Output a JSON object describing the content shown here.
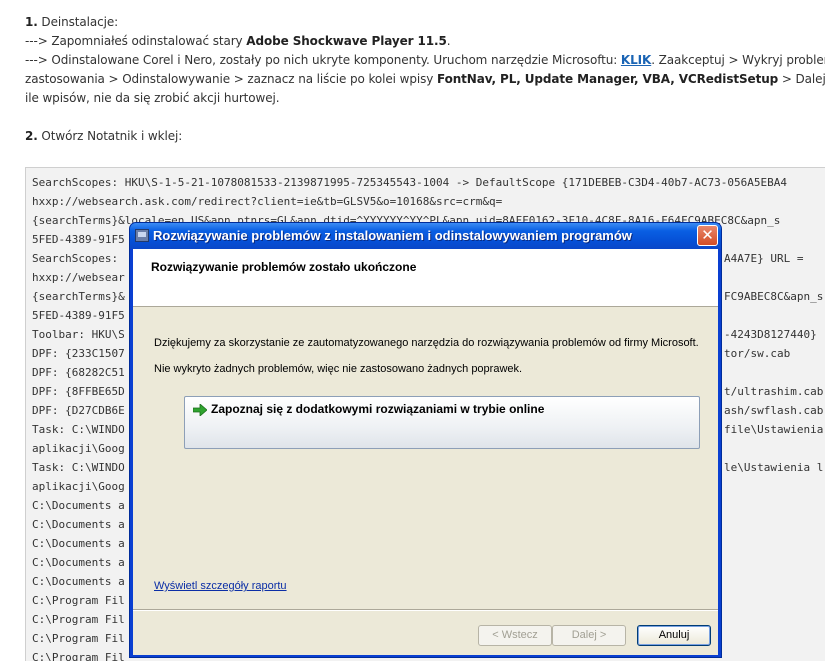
{
  "forum": {
    "line1_num": "1.",
    "line1_text": " Deinstalacje:",
    "line2_prefix": "---> Zapomniałeś odinstalować stary ",
    "line2_bold": "Adobe Shockwave Player 11.5",
    "line2_suffix": ".",
    "line3_prefix": "---> Odinstalowane Corel i Nero, zostały po nich ukryte komponenty. Uruchom narzędzie Microsoftu: ",
    "line3_link": "KLIK",
    "line3_suffix": ". Zaakceptuj > Wykryj problemy i pozwo",
    "line4_prefix": "zastosowania > Odinstalowywanie > zaznacz na liście po kolei wpisy ",
    "line4_bold": "FontNav, PL, Update Manager, VBA, VCRedistSetup",
    "line4_suffix": " > Dalej. Program na",
    "line5_text": "ile wpisów, nie da się zrobić akcji hurtowej.",
    "line6_num": "2.",
    "line6_text": " Otwórz Notatnik i wklej:"
  },
  "code_lines": [
    "SearchScopes: HKU\\S-1-5-21-1078081533-2139871995-725345543-1004 -> DefaultScope {171DEBEB-C3D4-40b7-AC73-056A5EBA4",
    "hxxp://websearch.ask.com/redirect?client=ie&tb=GLSV5&o=10168&src=crm&q=",
    "{searchTerms}&locale=en_US&apn_ptnrs=GL&apn_dtid=^YYYYYY^YY^PL&apn_uid=8AFF0162-3F10-4C8F-8A16-F64FC9ABEC8C&apn_s",
    "5FED-4389-91F5",
    "SearchScopes: ",
    "hxxp://websear",
    "{searchTerms}&",
    "5FED-4389-91F5",
    "Toolbar: HKU\\S",
    "DPF: {233C1507",
    "DPF: {68282C51",
    "DPF: {8FFBE65D",
    "DPF: {D27CDB6E",
    "Task: C:\\WINDO",
    "aplikacji\\Goog",
    "Task: C:\\WINDO",
    "aplikacji\\Goog",
    "C:\\Documents a",
    "C:\\Documents a",
    "C:\\Documents a",
    "C:\\Documents a",
    "C:\\Documents a",
    "C:\\Program Fil",
    "C:\\Program Fil",
    "C:\\Program Fil",
    "C:\\Program Fil"
  ],
  "code_right": {
    "r4": "A4A7E} URL =",
    "r6": "FC9ABEC8C&apn_s",
    "r8": "-4243D8127440}",
    "r9": "tor/sw.cab",
    "r11": "t/ultrashim.cab",
    "r12": "ash/swflash.cab",
    "r13": "file\\Ustawienia",
    "r15": "le\\Ustawienia l"
  },
  "dialog": {
    "title": "Rozwiązywanie problemów z instalowaniem i odinstalowywaniem programów",
    "close_glyph": "✕",
    "header_title": "Rozwiązywanie problemów zostało ukończone",
    "thanks_text": "Dziękujemy za skorzystanie ze zautomatyzowanego narzędzia do rozwiązywania problemów od firmy Microsoft.",
    "result_text": "Nie wykryto żadnych problemów, więc nie zastosowano żadnych poprawek.",
    "online_option": "Zapoznaj się z dodatkowymi rozwiązaniami w trybie online",
    "details_link": "Wyświetl szczegóły raportu",
    "back_label": "< Wstecz",
    "next_label": "Dalej >",
    "cancel_label": "Anuluj"
  },
  "colors": {
    "titlebar": "#0a5fe3",
    "link": "#1a64b4",
    "arrow": "#2fa32f"
  }
}
